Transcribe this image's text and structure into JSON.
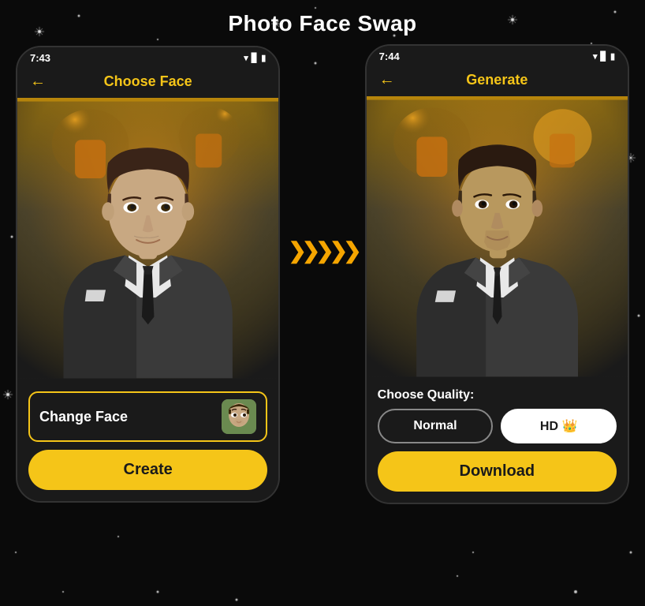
{
  "page": {
    "title": "Photo Face Swap",
    "background_color": "#0a0a0a"
  },
  "phone1": {
    "status_time": "7:43",
    "header_title": "Choose Face",
    "back_arrow": "←",
    "change_face_label": "Change Face",
    "create_button": "Create"
  },
  "phone2": {
    "status_time": "7:44",
    "header_title": "Generate",
    "back_arrow": "←",
    "choose_quality_label": "Choose Quality:",
    "normal_label": "Normal",
    "hd_label": "HD 👑",
    "download_button": "Download"
  },
  "arrows": "❯❯❯❯❯",
  "icons": {
    "back": "←",
    "wifi": "▼",
    "signal": "▌",
    "battery": "▮"
  }
}
